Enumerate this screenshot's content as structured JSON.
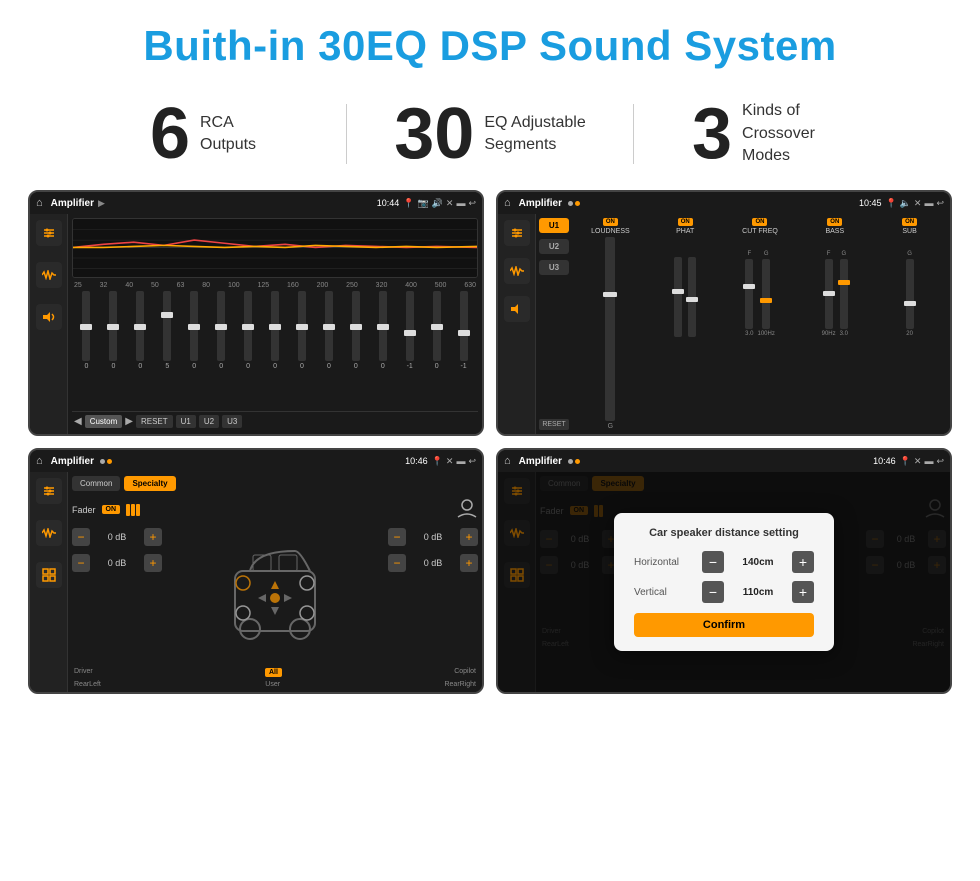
{
  "header": {
    "title": "Buith-in 30EQ DSP Sound System"
  },
  "stats": [
    {
      "number": "6",
      "label": "RCA\nOutputs"
    },
    {
      "number": "30",
      "label": "EQ Adjustable\nSegments"
    },
    {
      "number": "3",
      "label": "Kinds of\nCrossover Modes"
    }
  ],
  "screens": [
    {
      "id": "screen1",
      "title": "Amplifier",
      "time": "10:44",
      "type": "eq"
    },
    {
      "id": "screen2",
      "title": "Amplifier",
      "time": "10:45",
      "type": "amp"
    },
    {
      "id": "screen3",
      "title": "Amplifier",
      "time": "10:46",
      "type": "speaker"
    },
    {
      "id": "screen4",
      "title": "Amplifier",
      "time": "10:46",
      "type": "distance",
      "dialog": {
        "title": "Car speaker distance setting",
        "horizontal_label": "Horizontal",
        "horizontal_value": "140cm",
        "vertical_label": "Vertical",
        "vertical_value": "110cm",
        "confirm_label": "Confirm"
      }
    }
  ],
  "eq_freqs": [
    "25",
    "32",
    "40",
    "50",
    "63",
    "80",
    "100",
    "125",
    "160",
    "200",
    "250",
    "320",
    "400",
    "500",
    "630"
  ],
  "eq_values": [
    "0",
    "0",
    "0",
    "5",
    "0",
    "0",
    "0",
    "0",
    "0",
    "0",
    "0",
    "0",
    "-1",
    "0",
    "-1"
  ],
  "amp_channels": [
    {
      "name": "LOUDNESS",
      "on": true
    },
    {
      "name": "PHAT",
      "on": true
    },
    {
      "name": "CUT FREQ",
      "on": true
    },
    {
      "name": "BASS",
      "on": true
    },
    {
      "name": "SUB",
      "on": true
    }
  ],
  "presets": [
    "U1",
    "U2",
    "U3"
  ],
  "buttons": {
    "custom": "Custom",
    "reset": "RESET",
    "u1": "U1",
    "u2": "U2",
    "u3": "U3",
    "common": "Common",
    "specialty": "Specialty",
    "fader": "Fader",
    "on": "ON",
    "driver": "Driver",
    "copilot": "Copilot",
    "rear_left": "RearLeft",
    "all": "All",
    "user": "User",
    "rear_right": "RearRight"
  }
}
